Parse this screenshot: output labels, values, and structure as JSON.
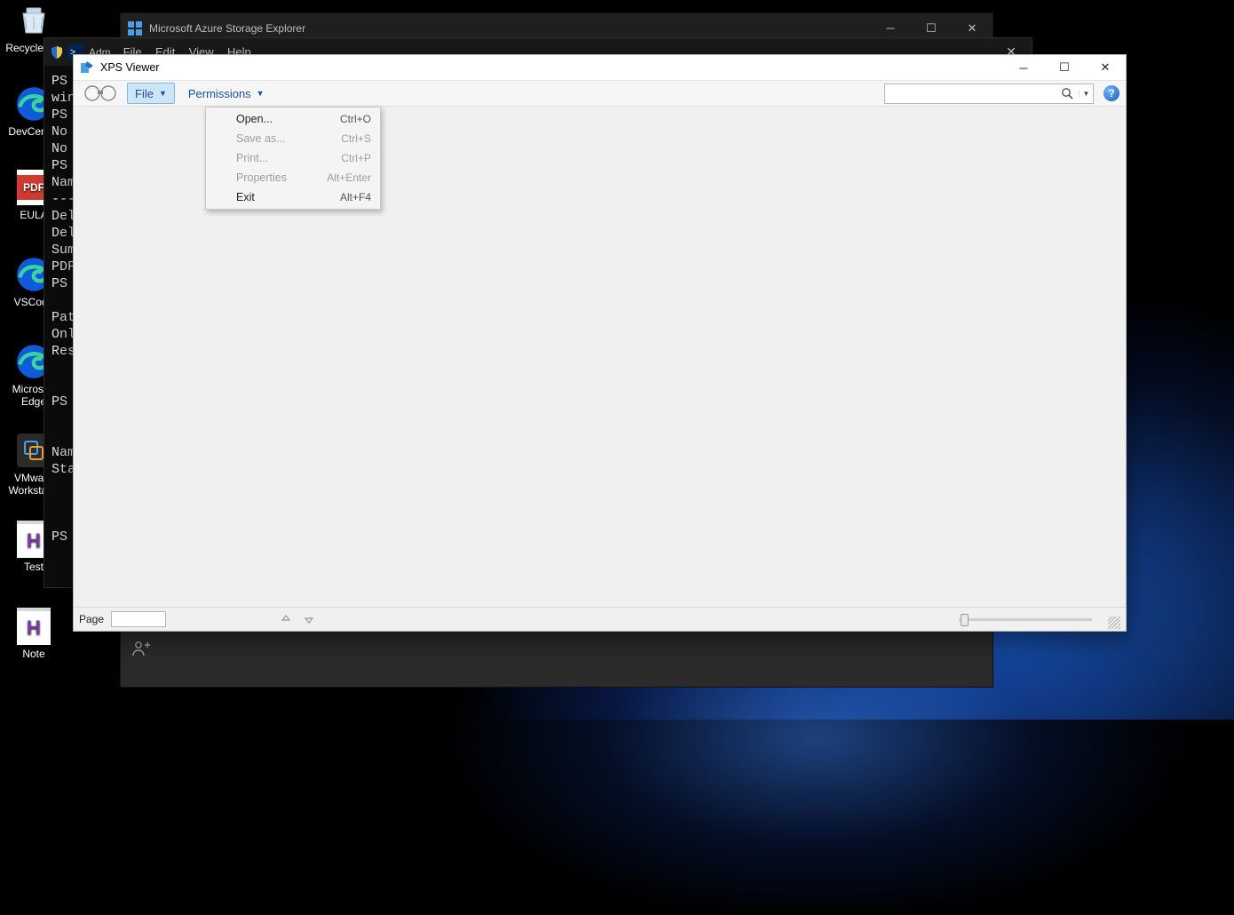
{
  "desktop": {
    "icons": [
      {
        "label": "Recycle Bin"
      },
      {
        "label": "DevCenter"
      },
      {
        "label": "EULA"
      },
      {
        "label": "VSCode"
      },
      {
        "label": "Microsoft Edge"
      },
      {
        "label": "VMware Workstat..."
      },
      {
        "label": "Test"
      },
      {
        "label": "Note"
      }
    ]
  },
  "azure": {
    "title": "Microsoft Azure Storage Explorer"
  },
  "powershell": {
    "title_prefix": "Adm",
    "menus": [
      "File",
      "Edit",
      "View",
      "Help"
    ],
    "lines": [
      "PS",
      "win",
      "PS",
      "No",
      "No",
      "PS",
      "Nam",
      "---",
      "Del",
      "Del",
      "Sum",
      "PDF",
      "PS",
      "",
      "Pat",
      "Onl",
      "Res",
      "",
      "",
      "PS",
      "",
      "",
      "Nam",
      "Sta",
      "",
      "",
      "",
      "PS"
    ]
  },
  "xps": {
    "title": "XPS Viewer",
    "toolbar": {
      "file": "File",
      "permissions": "Permissions"
    },
    "search_placeholder": "",
    "file_menu": [
      {
        "label": "Open...",
        "shortcut": "Ctrl+O",
        "enabled": true
      },
      {
        "label": "Save as...",
        "shortcut": "Ctrl+S",
        "enabled": false
      },
      {
        "label": "Print...",
        "shortcut": "Ctrl+P",
        "enabled": false
      },
      {
        "label": "Properties",
        "shortcut": "Alt+Enter",
        "enabled": false
      },
      {
        "label": "Exit",
        "shortcut": "Alt+F4",
        "enabled": true
      }
    ],
    "status": {
      "page_label": "Page"
    }
  }
}
